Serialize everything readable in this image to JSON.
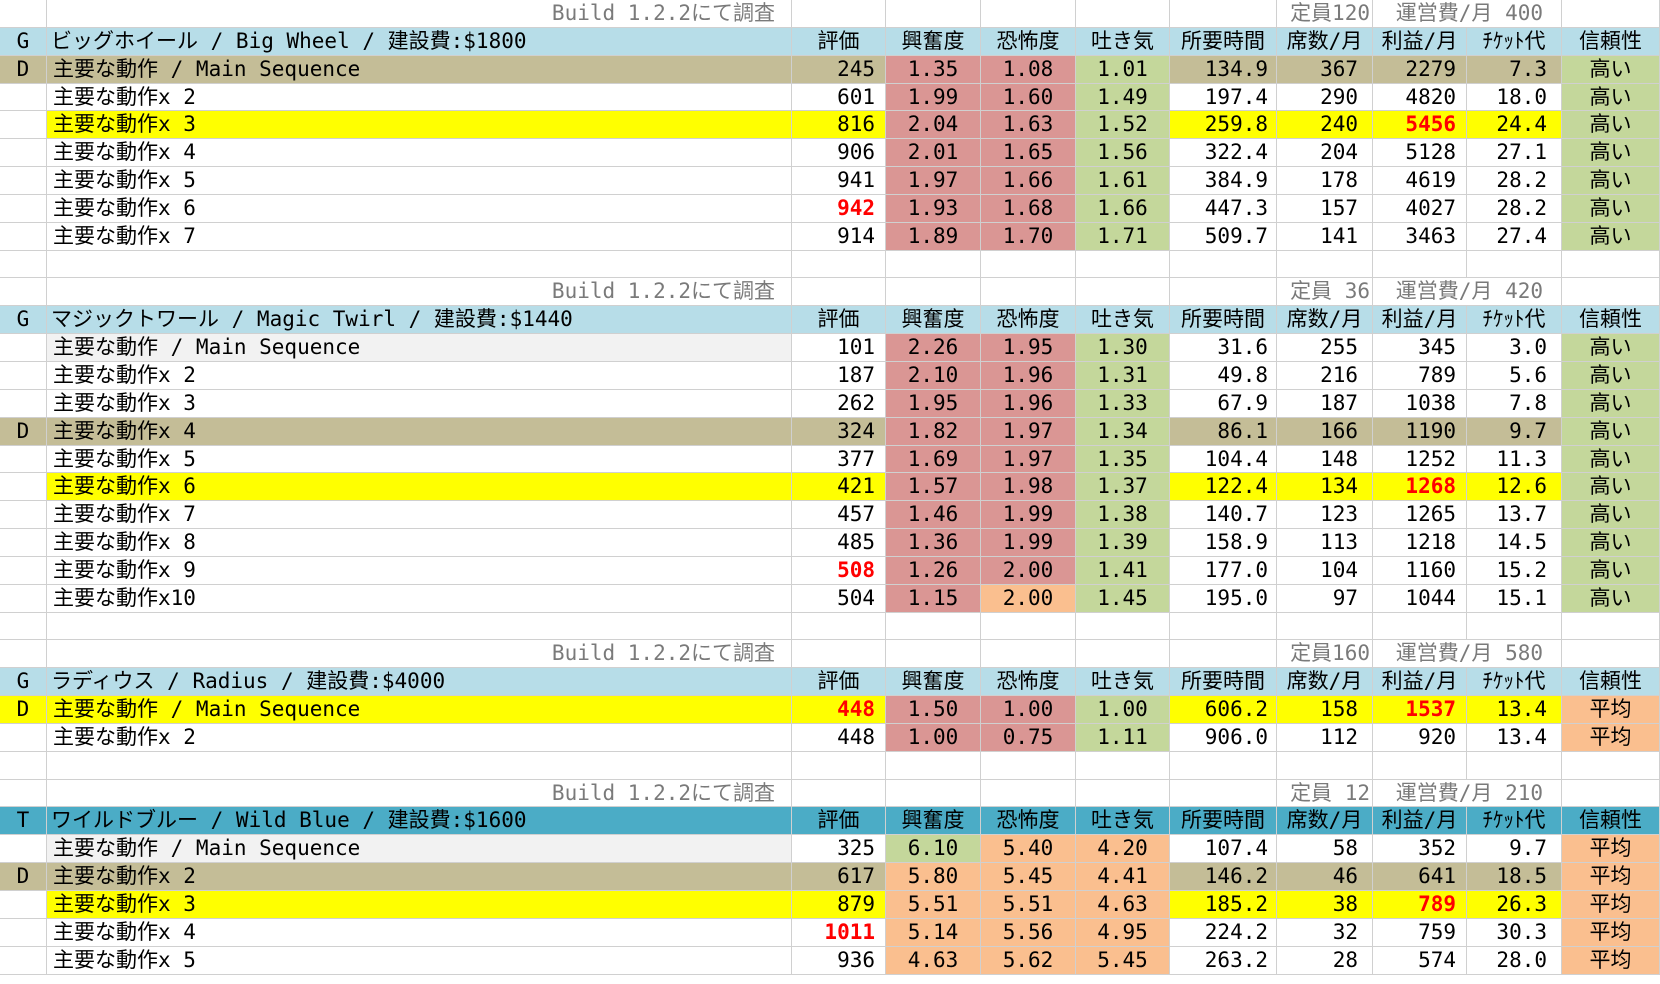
{
  "colors": {
    "header_blue": "#b7dde8",
    "header_teal": "#4bacc6",
    "default_row": "#c4bd97",
    "best_row": "#ffff00",
    "pink": "#da9694",
    "green": "#c4d79b",
    "orange": "#fabf8f",
    "light_gray": "#f2f2f2",
    "highlight_text": "#ff0000"
  },
  "headers": {
    "rating": "評価",
    "excitement": "興奮度",
    "intensity": "恐怖度",
    "nausea": "吐き気",
    "duration": "所要時間",
    "seats": "席数/月",
    "profit": "利益/月",
    "ticket": "ﾁｹｯﾄ代",
    "reliability": "信頼性"
  },
  "sections": [
    {
      "build_note": "Build 1.2.2にて調査",
      "capacity": "定員120",
      "cost": "運営費/月 400",
      "tag": "G",
      "title": "ビッグホイール / Big Wheel / 建設費:$1800",
      "rows": [
        {
          "mark": "D",
          "name": "主要な動作 / Main Sequence",
          "rating": "245",
          "excitement": "1.35",
          "intensity": "1.08",
          "nausea": "1.01",
          "duration": "134.9",
          "seats": "367",
          "profit": "2279",
          "ticket": "7.3",
          "reliability": "高い"
        },
        {
          "mark": "",
          "name": "主要な動作x 2",
          "rating": "601",
          "excitement": "1.99",
          "intensity": "1.60",
          "nausea": "1.49",
          "duration": "197.4",
          "seats": "290",
          "profit": "4820",
          "ticket": "18.0",
          "reliability": "高い"
        },
        {
          "mark": "",
          "name": "主要な動作x 3",
          "rating": "816",
          "excitement": "2.04",
          "intensity": "1.63",
          "nausea": "1.52",
          "duration": "259.8",
          "seats": "240",
          "profit": "5456",
          "ticket": "24.4",
          "reliability": "高い"
        },
        {
          "mark": "",
          "name": "主要な動作x 4",
          "rating": "906",
          "excitement": "2.01",
          "intensity": "1.65",
          "nausea": "1.56",
          "duration": "322.4",
          "seats": "204",
          "profit": "5128",
          "ticket": "27.1",
          "reliability": "高い"
        },
        {
          "mark": "",
          "name": "主要な動作x 5",
          "rating": "941",
          "excitement": "1.97",
          "intensity": "1.66",
          "nausea": "1.61",
          "duration": "384.9",
          "seats": "178",
          "profit": "4619",
          "ticket": "28.2",
          "reliability": "高い"
        },
        {
          "mark": "",
          "name": "主要な動作x 6",
          "rating": "942",
          "excitement": "1.93",
          "intensity": "1.68",
          "nausea": "1.66",
          "duration": "447.3",
          "seats": "157",
          "profit": "4027",
          "ticket": "28.2",
          "reliability": "高い"
        },
        {
          "mark": "",
          "name": "主要な動作x 7",
          "rating": "914",
          "excitement": "1.89",
          "intensity": "1.70",
          "nausea": "1.71",
          "duration": "509.7",
          "seats": "141",
          "profit": "3463",
          "ticket": "27.4",
          "reliability": "高い"
        }
      ]
    },
    {
      "build_note": "Build 1.2.2にて調査",
      "capacity": "定員 36",
      "cost": "運営費/月 420",
      "tag": "G",
      "title": "マジックトワール / Magic Twirl / 建設費:$1440",
      "rows": [
        {
          "mark": "",
          "name": "主要な動作 / Main Sequence",
          "rating": "101",
          "excitement": "2.26",
          "intensity": "1.95",
          "nausea": "1.30",
          "duration": "31.6",
          "seats": "255",
          "profit": "345",
          "ticket": "3.0",
          "reliability": "高い"
        },
        {
          "mark": "",
          "name": "主要な動作x 2",
          "rating": "187",
          "excitement": "2.10",
          "intensity": "1.96",
          "nausea": "1.31",
          "duration": "49.8",
          "seats": "216",
          "profit": "789",
          "ticket": "5.6",
          "reliability": "高い"
        },
        {
          "mark": "",
          "name": "主要な動作x 3",
          "rating": "262",
          "excitement": "1.95",
          "intensity": "1.96",
          "nausea": "1.33",
          "duration": "67.9",
          "seats": "187",
          "profit": "1038",
          "ticket": "7.8",
          "reliability": "高い"
        },
        {
          "mark": "D",
          "name": "主要な動作x 4",
          "rating": "324",
          "excitement": "1.82",
          "intensity": "1.97",
          "nausea": "1.34",
          "duration": "86.1",
          "seats": "166",
          "profit": "1190",
          "ticket": "9.7",
          "reliability": "高い"
        },
        {
          "mark": "",
          "name": "主要な動作x 5",
          "rating": "377",
          "excitement": "1.69",
          "intensity": "1.97",
          "nausea": "1.35",
          "duration": "104.4",
          "seats": "148",
          "profit": "1252",
          "ticket": "11.3",
          "reliability": "高い"
        },
        {
          "mark": "",
          "name": "主要な動作x 6",
          "rating": "421",
          "excitement": "1.57",
          "intensity": "1.98",
          "nausea": "1.37",
          "duration": "122.4",
          "seats": "134",
          "profit": "1268",
          "ticket": "12.6",
          "reliability": "高い"
        },
        {
          "mark": "",
          "name": "主要な動作x 7",
          "rating": "457",
          "excitement": "1.46",
          "intensity": "1.99",
          "nausea": "1.38",
          "duration": "140.7",
          "seats": "123",
          "profit": "1265",
          "ticket": "13.7",
          "reliability": "高い"
        },
        {
          "mark": "",
          "name": "主要な動作x 8",
          "rating": "485",
          "excitement": "1.36",
          "intensity": "1.99",
          "nausea": "1.39",
          "duration": "158.9",
          "seats": "113",
          "profit": "1218",
          "ticket": "14.5",
          "reliability": "高い"
        },
        {
          "mark": "",
          "name": "主要な動作x 9",
          "rating": "508",
          "excitement": "1.26",
          "intensity": "2.00",
          "nausea": "1.41",
          "duration": "177.0",
          "seats": "104",
          "profit": "1160",
          "ticket": "15.2",
          "reliability": "高い"
        },
        {
          "mark": "",
          "name": "主要な動作x10",
          "rating": "504",
          "excitement": "1.15",
          "intensity": "2.00",
          "nausea": "1.45",
          "duration": "195.0",
          "seats": "97",
          "profit": "1044",
          "ticket": "15.1",
          "reliability": "高い"
        }
      ]
    },
    {
      "build_note": "Build 1.2.2にて調査",
      "capacity": "定員160",
      "cost": "運営費/月 580",
      "tag": "G",
      "title": "ラディウス / Radius / 建設費:$4000",
      "rows": [
        {
          "mark": "D",
          "name": "主要な動作 / Main Sequence",
          "rating": "448",
          "excitement": "1.50",
          "intensity": "1.00",
          "nausea": "1.00",
          "duration": "606.2",
          "seats": "158",
          "profit": "1537",
          "ticket": "13.4",
          "reliability": "平均"
        },
        {
          "mark": "",
          "name": "主要な動作x 2",
          "rating": "448",
          "excitement": "1.00",
          "intensity": "0.75",
          "nausea": "1.11",
          "duration": "906.0",
          "seats": "112",
          "profit": "920",
          "ticket": "13.4",
          "reliability": "平均"
        }
      ]
    },
    {
      "build_note": "Build 1.2.2にて調査",
      "capacity": "定員 12",
      "cost": "運営費/月 210",
      "tag": "T",
      "title": "ワイルドブルー / Wild Blue / 建設費:$1600",
      "rows": [
        {
          "mark": "",
          "name": "主要な動作 / Main Sequence",
          "rating": "325",
          "excitement": "6.10",
          "intensity": "5.40",
          "nausea": "4.20",
          "duration": "107.4",
          "seats": "58",
          "profit": "352",
          "ticket": "9.7",
          "reliability": "平均"
        },
        {
          "mark": "D",
          "name": "主要な動作x 2",
          "rating": "617",
          "excitement": "5.80",
          "intensity": "5.45",
          "nausea": "4.41",
          "duration": "146.2",
          "seats": "46",
          "profit": "641",
          "ticket": "18.5",
          "reliability": "平均"
        },
        {
          "mark": "",
          "name": "主要な動作x 3",
          "rating": "879",
          "excitement": "5.51",
          "intensity": "5.51",
          "nausea": "4.63",
          "duration": "185.2",
          "seats": "38",
          "profit": "789",
          "ticket": "26.3",
          "reliability": "平均"
        },
        {
          "mark": "",
          "name": "主要な動作x 4",
          "rating": "1011",
          "excitement": "5.14",
          "intensity": "5.56",
          "nausea": "4.95",
          "duration": "224.2",
          "seats": "32",
          "profit": "759",
          "ticket": "30.3",
          "reliability": "平均"
        },
        {
          "mark": "",
          "name": "主要な動作x 5",
          "rating": "936",
          "excitement": "4.63",
          "intensity": "5.62",
          "nausea": "5.45",
          "duration": "263.2",
          "seats": "28",
          "profit": "574",
          "ticket": "28.0",
          "reliability": "平均"
        }
      ]
    }
  ]
}
